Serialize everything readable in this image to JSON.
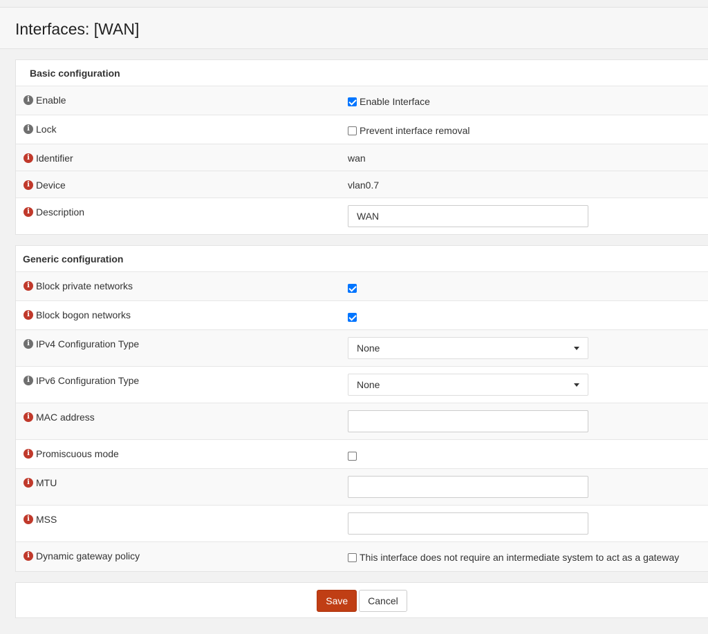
{
  "page": {
    "title": "Interfaces: [WAN]"
  },
  "basic": {
    "heading": "Basic configuration",
    "enable": {
      "label": "Enable",
      "checked": true,
      "text": "Enable Interface"
    },
    "lock": {
      "label": "Lock",
      "checked": false,
      "text": "Prevent interface removal"
    },
    "identifier": {
      "label": "Identifier",
      "value": "wan"
    },
    "device": {
      "label": "Device",
      "value": "vlan0.7"
    },
    "description": {
      "label": "Description",
      "value": "WAN"
    }
  },
  "generic": {
    "heading": "Generic configuration",
    "block_private": {
      "label": "Block private networks",
      "checked": true
    },
    "block_bogon": {
      "label": "Block bogon networks",
      "checked": true
    },
    "ipv4_type": {
      "label": "IPv4 Configuration Type",
      "value": "None"
    },
    "ipv6_type": {
      "label": "IPv6 Configuration Type",
      "value": "None"
    },
    "mac": {
      "label": "MAC address",
      "value": ""
    },
    "promisc": {
      "label": "Promiscuous mode",
      "checked": false
    },
    "mtu": {
      "label": "MTU",
      "value": ""
    },
    "mss": {
      "label": "MSS",
      "value": ""
    },
    "dyn_gw": {
      "label": "Dynamic gateway policy",
      "checked": false,
      "text": "This interface does not require an intermediate system to act as a gateway"
    }
  },
  "actions": {
    "save_label": "Save",
    "cancel_label": "Cancel"
  },
  "colors": {
    "accent": "#c03e14",
    "info_grey": "#6f6f6f",
    "info_red": "#c0392b",
    "checkbox": "#0075ff"
  },
  "icons": {
    "info": "info-icon",
    "caret": "chevron-down-icon"
  }
}
